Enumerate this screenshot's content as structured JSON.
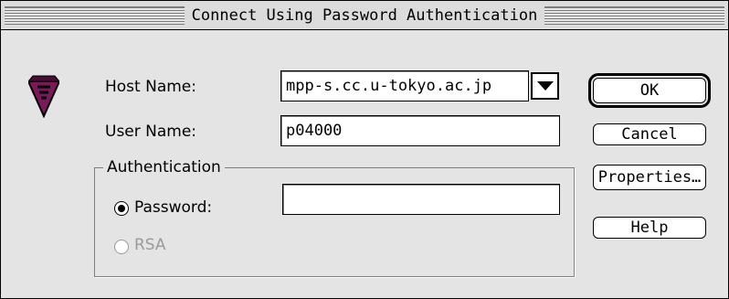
{
  "dialog": {
    "title": "Connect Using Password Authentication"
  },
  "form": {
    "host_label": "Host Name:",
    "host_value": "mpp-s.cc.u-tokyo.ac.jp",
    "user_label": "User Name:",
    "user_value": "p04000",
    "auth_group_label": "Authentication",
    "password_label": "Password:",
    "password_value": "",
    "rsa_label": "RSA",
    "selected_auth": "Password"
  },
  "buttons": {
    "ok": "OK",
    "cancel": "Cancel",
    "properties": "Properties…",
    "help": "Help"
  },
  "colors": {
    "logo": "#7a1a5a",
    "disabled_text": "#9a9a9a"
  }
}
